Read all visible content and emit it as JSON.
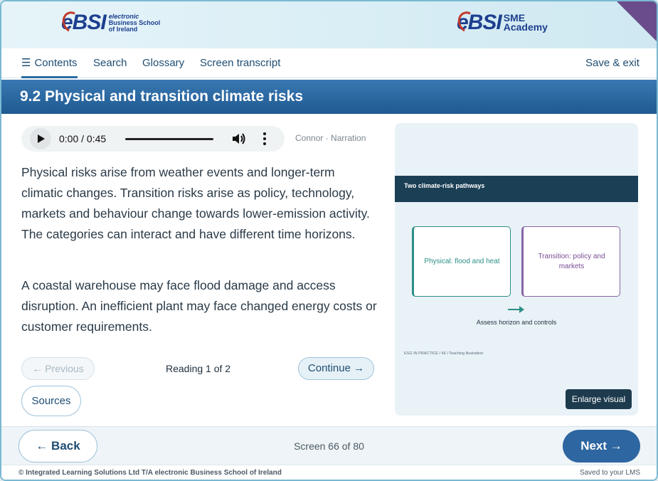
{
  "brand": {
    "left_logo_mark": "eBSI",
    "left_logo_text": [
      "electronic",
      "Business School",
      "of Ireland"
    ],
    "right_logo_mark": "eBSI",
    "right_logo_text": [
      "SME",
      "Academy"
    ],
    "corner_color": "#6a4c8c"
  },
  "nav": {
    "contents_label": "Contents",
    "search_label": "Search",
    "glossary_label": "Glossary",
    "transcript_label": "Screen transcript",
    "save_exit_label": "Save & exit"
  },
  "page": {
    "title": "9.2 Physical and transition climate risks"
  },
  "audio": {
    "time": "0:00 / 0:45",
    "narrator": "Connor · Narration"
  },
  "content": {
    "paragraph_1": "Physical risks arise from weather events and longer-term climatic changes. Transition risks arise as policy, technology, markets and behaviour change towards lower-emission activity. The categories can interact and have different time horizons.",
    "paragraph_2": "A coastal warehouse may face flood damage and access disruption. An inefficient plant may face changed energy costs or customer requirements."
  },
  "reading_nav": {
    "previous_label": "← Previous",
    "status": "Reading 1 of 2",
    "continue_label": "Continue →",
    "sources_label": "Sources"
  },
  "visual": {
    "header": "Two climate-risk pathways",
    "box_physical": "Physical: flood and heat",
    "box_transition": "Transition: policy and markets",
    "caption": "Assess horizon and controls",
    "footnote": "ESG IN PRACTICE / 66 / Teaching illustration",
    "enlarge_label": "Enlarge visual",
    "physical_color": "#2a8f86",
    "transition_color": "#8a64a8"
  },
  "footer": {
    "back_label": "← Back",
    "screen_count": "Screen 66 of 80",
    "next_label": "Next →",
    "legal": "© Integrated Learning Solutions Ltd T/A electronic Business School of Ireland",
    "saved": "Saved to your LMS"
  }
}
